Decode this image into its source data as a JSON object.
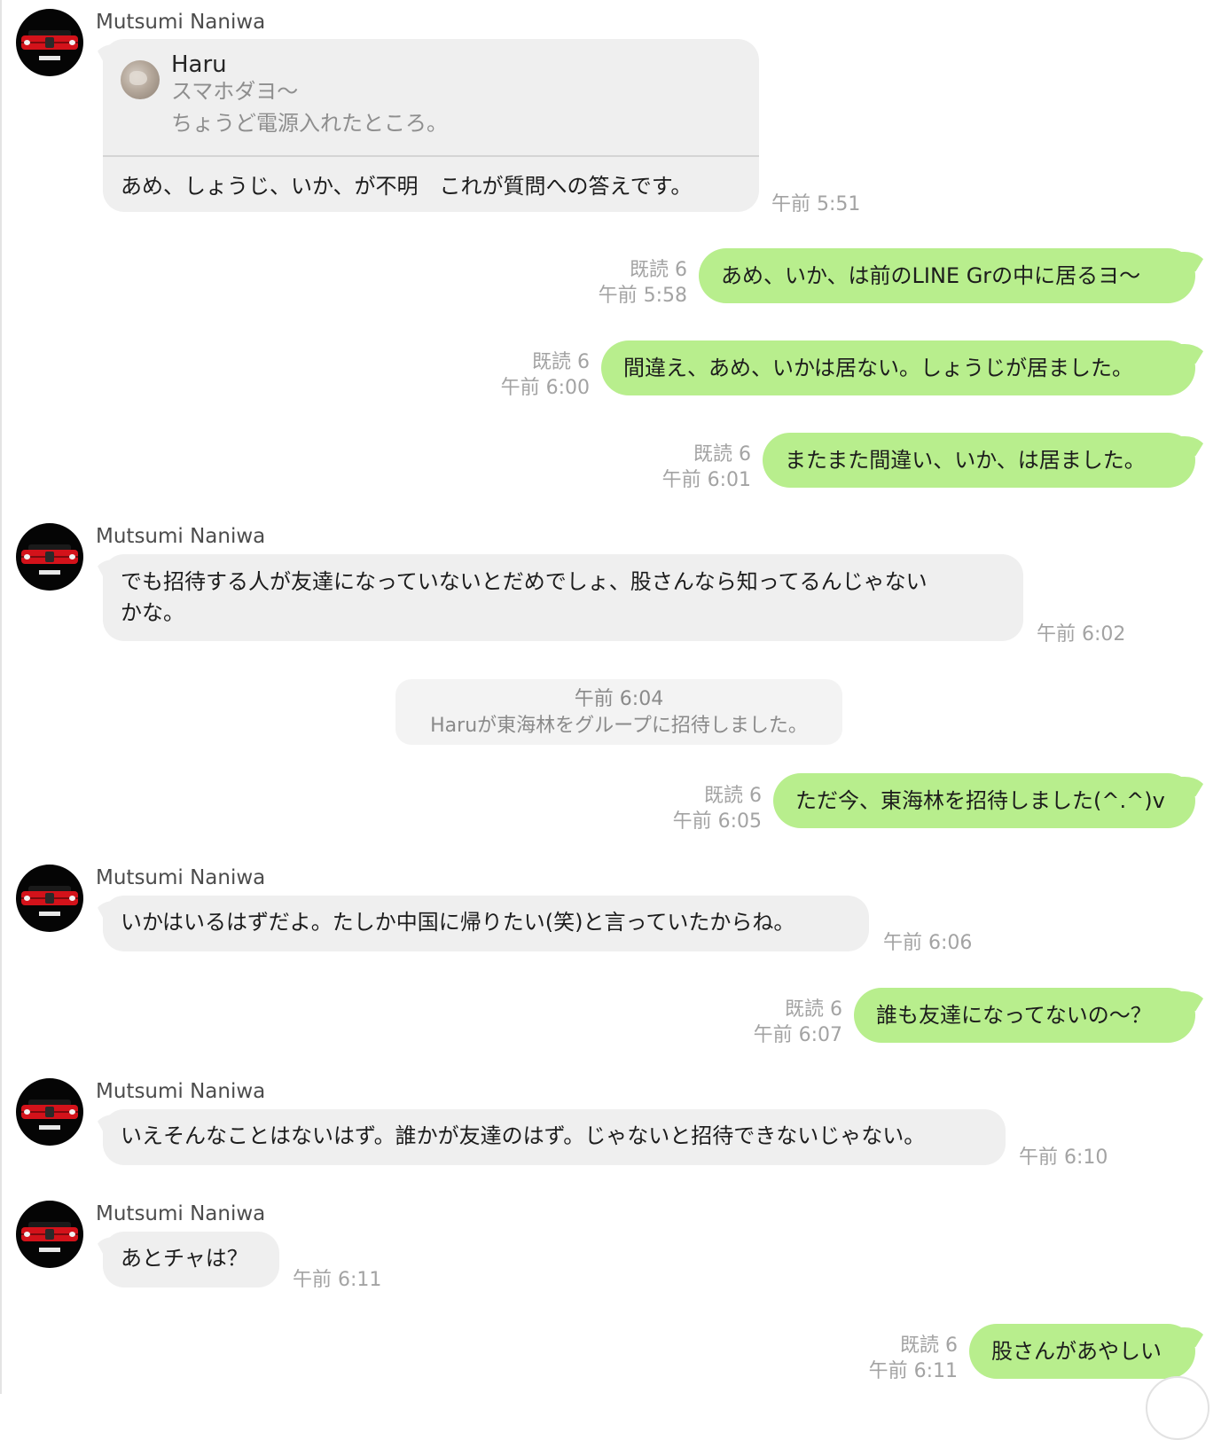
{
  "messages": [
    {
      "sender": "Mutsumi Naniwa",
      "reply": {
        "name": "Haru",
        "line1": "スマホダヨ〜",
        "line2": "ちょうど電源入れたところ。"
      },
      "text": "あめ、しょうじ、いか、が不明　これが質問への答えです。",
      "time": "午前 5:51"
    },
    {
      "read": "既読 6",
      "time": "午前 5:58",
      "text": "あめ、いか、は前のLINE Grの中に居るヨ〜"
    },
    {
      "read": "既読 6",
      "time": "午前 6:00",
      "text": "間違え、あめ、いかは居ない。しょうじが居ました。"
    },
    {
      "read": "既読 6",
      "time": "午前 6:01",
      "text": "またまた間違い、いか、は居ました。"
    },
    {
      "sender": "Mutsumi Naniwa",
      "line1": "でも招待する人が友達になっていないとだめでしょ、股さんなら知ってるんじゃない",
      "line2": "かな。",
      "time": "午前 6:02"
    },
    {
      "system_time": "午前 6:04",
      "system_text": "Haruが東海林をグループに招待しました。"
    },
    {
      "read": "既読 6",
      "time": "午前 6:05",
      "text": "ただ今、東海林を招待しました(^.^)v"
    },
    {
      "sender": "Mutsumi Naniwa",
      "text": "いかはいるはずだよ。たしか中国に帰りたい(笑)と言っていたからね。",
      "time": "午前 6:06"
    },
    {
      "read": "既読 6",
      "time": "午前 6:07",
      "text": "誰も友達になってないの〜？"
    },
    {
      "sender": "Mutsumi Naniwa",
      "text": "いえそんなことはないはず。誰かが友達のはず。じゃないと招待できないじゃない。",
      "time": "午前 6:10"
    },
    {
      "sender": "Mutsumi Naniwa",
      "text": "あとチャは？",
      "time": "午前 6:11"
    },
    {
      "read": "既読 6",
      "time": "午前 6:11",
      "text": "股さんがあやしい"
    }
  ]
}
